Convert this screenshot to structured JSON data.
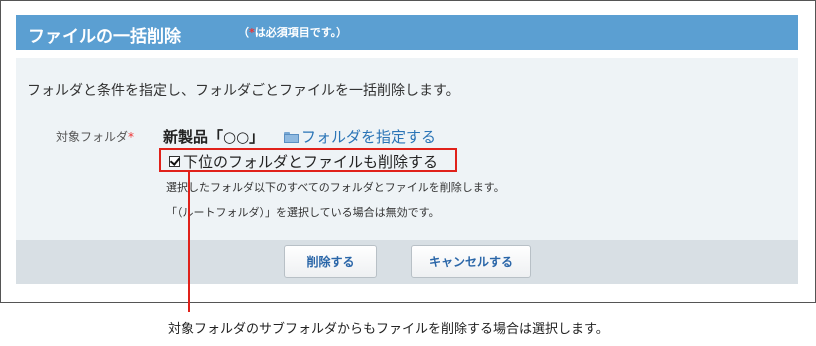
{
  "header": {
    "title": "ファイルの一括削除",
    "note_open": "（",
    "note_required_mark": "*",
    "note_text": "は必須項目です。）"
  },
  "description": "フォルダと条件を指定し、フォルダごとファイルを一括削除します。",
  "form": {
    "folder_label": "対象フォルダ",
    "required_mark": "*",
    "folder_name": "新製品「○○」",
    "folder_link": "フォルダを指定する",
    "checkbox_label": "下位のフォルダとファイルも削除する",
    "checkbox_checked": true,
    "hint_1": "選択したフォルダ以下のすべてのフォルダとファイルを削除します。",
    "hint_2": "「（ルートフォルダ）」を選択している場合は無効です。"
  },
  "buttons": {
    "delete": "削除する",
    "cancel": "キャンセルする"
  },
  "annotation": "対象フォルダのサブフォルダからもファイルを削除する場合は選択します。",
  "colors": {
    "header_bg": "#5b9fd2",
    "highlight": "#e0211a",
    "link": "#2a74b6"
  }
}
